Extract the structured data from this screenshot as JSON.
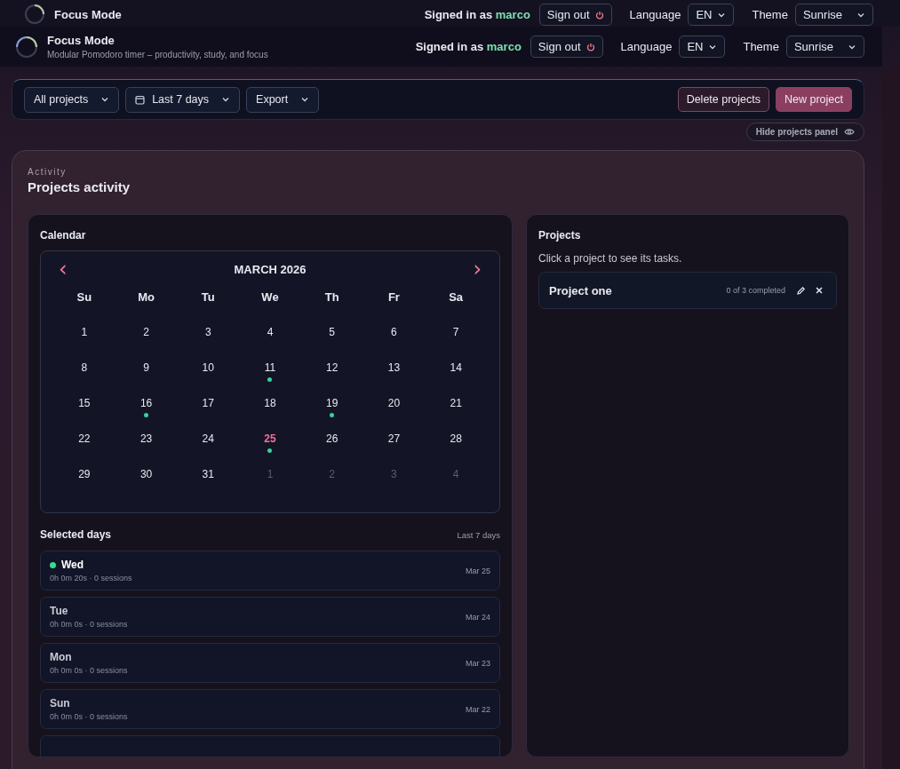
{
  "back_header": {
    "title": "Focus Mode",
    "signed_in_prefix": "Signed in as",
    "user": "marco",
    "sign_out": "Sign out",
    "language_label": "Language",
    "language": "EN",
    "theme_label": "Theme",
    "theme": "Sunrise"
  },
  "header": {
    "title": "Focus Mode",
    "subtitle": "Modular Pomodoro timer – productivity, study, and focus",
    "signed_in_prefix": "Signed in as",
    "user": "marco",
    "sign_out": "Sign out",
    "language_label": "Language",
    "language": "EN",
    "theme_label": "Theme",
    "theme": "Sunrise"
  },
  "toolbar": {
    "filters": [
      {
        "label": "All projects",
        "kind": "select"
      },
      {
        "label": "Last 7 days",
        "kind": "date"
      },
      {
        "label": "Export",
        "kind": "select"
      }
    ],
    "actions": [
      {
        "label": "Delete projects",
        "kind": "danger"
      },
      {
        "label": "New project",
        "kind": "primary"
      }
    ]
  },
  "panel_toggle": "Hide projects panel",
  "activity": {
    "eyebrow": "Activity",
    "title": "Projects activity",
    "calendar": {
      "heading": "Calendar",
      "month": "MARCH 2026",
      "prev": "‹",
      "next": "›",
      "weekdays": [
        "Su",
        "Mo",
        "Tu",
        "We",
        "Th",
        "Fr",
        "Sa"
      ],
      "weeks": [
        [
          {
            "day": "1",
            "activity": false,
            "today": false,
            "outside": false
          },
          {
            "day": "2",
            "activity": false,
            "today": false,
            "outside": false
          },
          {
            "day": "3",
            "activity": false,
            "today": false,
            "outside": false
          },
          {
            "day": "4",
            "activity": false,
            "today": false,
            "outside": false
          },
          {
            "day": "5",
            "activity": false,
            "today": false,
            "outside": false
          },
          {
            "day": "6",
            "activity": false,
            "today": false,
            "outside": false
          },
          {
            "day": "7",
            "activity": false,
            "today": false,
            "outside": false
          }
        ],
        [
          {
            "day": "8",
            "activity": false,
            "today": false,
            "outside": false
          },
          {
            "day": "9",
            "activity": false,
            "today": false,
            "outside": false
          },
          {
            "day": "10",
            "activity": false,
            "today": false,
            "outside": false
          },
          {
            "day": "11",
            "activity": true,
            "today": false,
            "outside": false
          },
          {
            "day": "12",
            "activity": false,
            "today": false,
            "outside": false
          },
          {
            "day": "13",
            "activity": false,
            "today": false,
            "outside": false
          },
          {
            "day": "14",
            "activity": false,
            "today": false,
            "outside": false
          }
        ],
        [
          {
            "day": "15",
            "activity": false,
            "today": false,
            "outside": false
          },
          {
            "day": "16",
            "activity": true,
            "today": false,
            "outside": false
          },
          {
            "day": "17",
            "activity": false,
            "today": false,
            "outside": false
          },
          {
            "day": "18",
            "activity": false,
            "today": false,
            "outside": false
          },
          {
            "day": "19",
            "activity": true,
            "today": false,
            "outside": false
          },
          {
            "day": "20",
            "activity": false,
            "today": false,
            "outside": false
          },
          {
            "day": "21",
            "activity": false,
            "today": false,
            "outside": false
          }
        ],
        [
          {
            "day": "22",
            "activity": false,
            "today": false,
            "outside": false
          },
          {
            "day": "23",
            "activity": false,
            "today": false,
            "outside": false
          },
          {
            "day": "24",
            "activity": false,
            "today": false,
            "outside": false
          },
          {
            "day": "25",
            "activity": true,
            "today": true,
            "outside": false
          },
          {
            "day": "26",
            "activity": false,
            "today": false,
            "outside": false
          },
          {
            "day": "27",
            "activity": false,
            "today": false,
            "outside": false
          },
          {
            "day": "28",
            "activity": false,
            "today": false,
            "outside": false
          }
        ],
        [
          {
            "day": "29",
            "activity": false,
            "today": false,
            "outside": false
          },
          {
            "day": "30",
            "activity": false,
            "today": false,
            "outside": false
          },
          {
            "day": "31",
            "activity": false,
            "today": false,
            "outside": false
          },
          {
            "day": "1",
            "activity": false,
            "today": false,
            "outside": true
          },
          {
            "day": "2",
            "activity": false,
            "today": false,
            "outside": true
          },
          {
            "day": "3",
            "activity": false,
            "today": false,
            "outside": true
          },
          {
            "day": "4",
            "activity": false,
            "today": false,
            "outside": true
          }
        ]
      ]
    },
    "selected_days": {
      "heading": "Selected days",
      "range": "Last 7 days",
      "items": [
        {
          "day": "Wed",
          "summary": "0h 0m 20s · 0 sessions",
          "date": "Mar 25",
          "active": true
        },
        {
          "day": "Tue",
          "summary": "0h 0m 0s · 0 sessions",
          "date": "Mar 24",
          "active": false
        },
        {
          "day": "Mon",
          "summary": "0h 0m 0s · 0 sessions",
          "date": "Mar 23",
          "active": false
        },
        {
          "day": "Sun",
          "summary": "0h 0m 0s · 0 sessions",
          "date": "Mar 22",
          "active": false
        }
      ]
    },
    "projects": {
      "heading": "Projects",
      "hint": "Click a project to see its tasks.",
      "items": [
        {
          "name": "Project one",
          "progress": "0 of 3 completed"
        }
      ]
    }
  }
}
